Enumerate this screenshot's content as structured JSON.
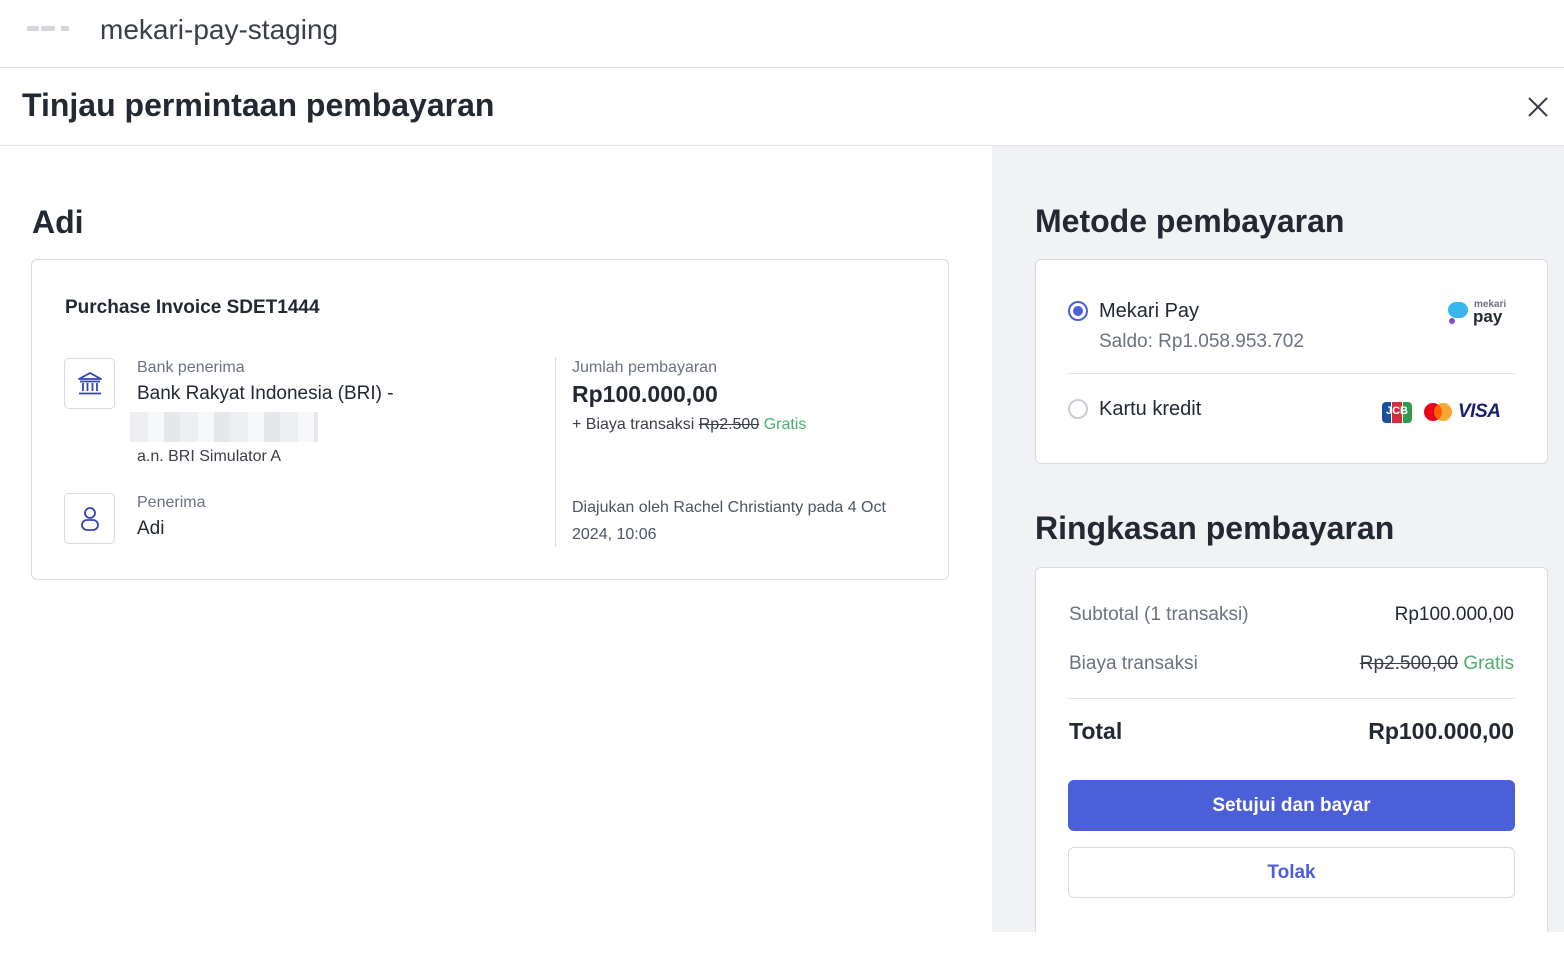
{
  "app_bar": {
    "title": "mekari-pay-staging"
  },
  "modal": {
    "title": "Tinjau permintaan pembayaran"
  },
  "request": {
    "recipient_heading": "Adi",
    "invoice_title": "Purchase Invoice SDET1444",
    "bank_label": "Bank penerima",
    "bank_value": "Bank Rakyat Indonesia (BRI) -",
    "account_holder": "a.n. BRI Simulator A",
    "recipient_label": "Penerima",
    "recipient_value": "Adi",
    "amount_label": "Jumlah pembayaran",
    "amount_value": "Rp100.000,00",
    "fee_prefix": "+ Biaya transaksi",
    "fee_original": "Rp2.500",
    "fee_free": "Gratis",
    "submitted_text": "Diajukan oleh Rachel Christianty pada 4 Oct 2024, 10:06"
  },
  "payment_method": {
    "title": "Metode pembayaran",
    "options": [
      {
        "label": "Mekari Pay",
        "balance": "Saldo: Rp1.058.953.702",
        "selected": true,
        "logo_small": "mekari",
        "logo_big": "pay"
      },
      {
        "label": "Kartu kredit",
        "selected": false,
        "brands": [
          "JCB",
          "Mastercard",
          "VISA"
        ]
      }
    ]
  },
  "summary": {
    "title": "Ringkasan pembayaran",
    "subtotal_label": "Subtotal (1 transaksi)",
    "subtotal_value": "Rp100.000,00",
    "fee_label": "Biaya transaksi",
    "fee_original": "Rp2.500,00",
    "fee_free": "Gratis",
    "total_label": "Total",
    "total_value": "Rp100.000,00",
    "approve_button": "Setujui dan bayar",
    "reject_button": "Tolak"
  },
  "colors": {
    "primary": "#4b5fd9",
    "success": "#4caf6f",
    "panel_bg": "#f1f2f4"
  },
  "icons": [
    "app-logo",
    "close-icon",
    "bank-icon",
    "person-icon",
    "radio-selected",
    "radio-unselected",
    "mekari-pay-logo",
    "jcb-icon",
    "mastercard-icon",
    "visa-icon"
  ]
}
